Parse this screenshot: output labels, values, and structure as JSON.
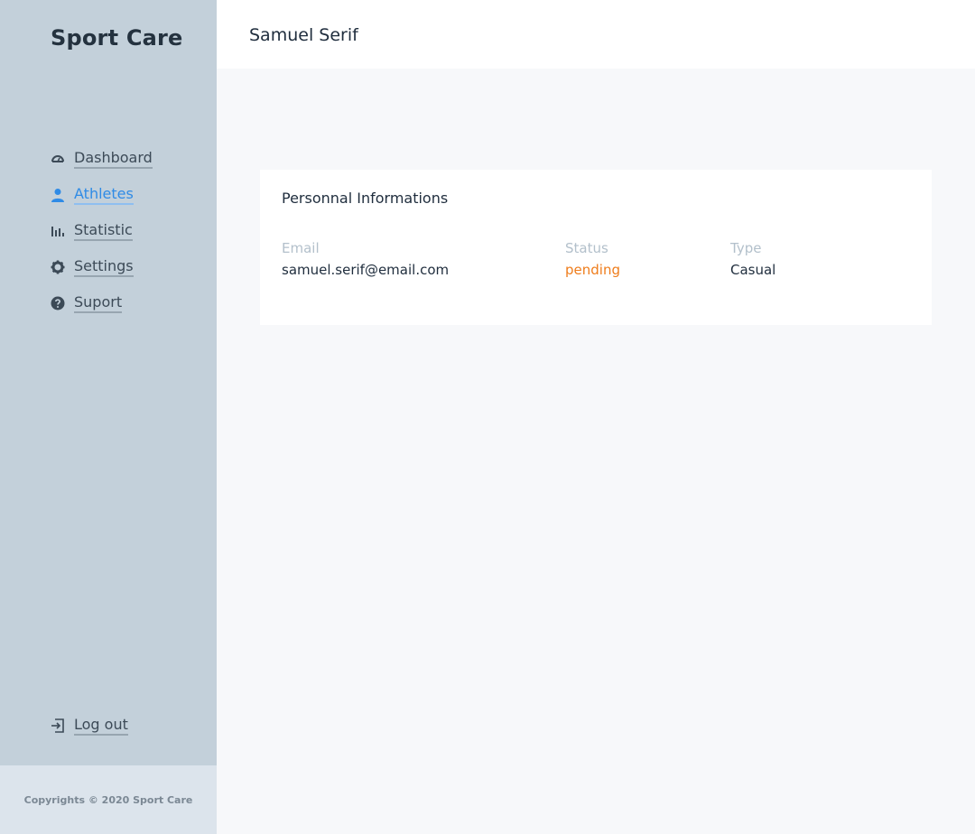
{
  "app": {
    "brand": "Sport Care"
  },
  "sidebar": {
    "items": [
      {
        "label": "Dashboard",
        "icon": "gauge-icon"
      },
      {
        "label": "Athletes",
        "icon": "user-icon",
        "active": true
      },
      {
        "label": "Statistic",
        "icon": "bar-chart-icon"
      },
      {
        "label": "Settings",
        "icon": "gear-icon"
      },
      {
        "label": "Suport",
        "icon": "help-icon"
      }
    ],
    "logout": {
      "label": "Log out",
      "icon": "logout-icon"
    },
    "footer": "Copyrights © 2020 Sport Care"
  },
  "header": {
    "title": "Samuel Serif"
  },
  "card": {
    "title": "Personnal Informations",
    "fields": [
      {
        "label": "Email",
        "value": "samuel.serif@email.com"
      },
      {
        "label": "Status",
        "value": "pending"
      },
      {
        "label": "Type",
        "value": "Casual"
      }
    ]
  },
  "colors": {
    "sidebar_bg": "#c3d0da",
    "active": "#2f8be6",
    "status_pending": "#ef7d1c",
    "content_bg": "#f7f8fa"
  }
}
